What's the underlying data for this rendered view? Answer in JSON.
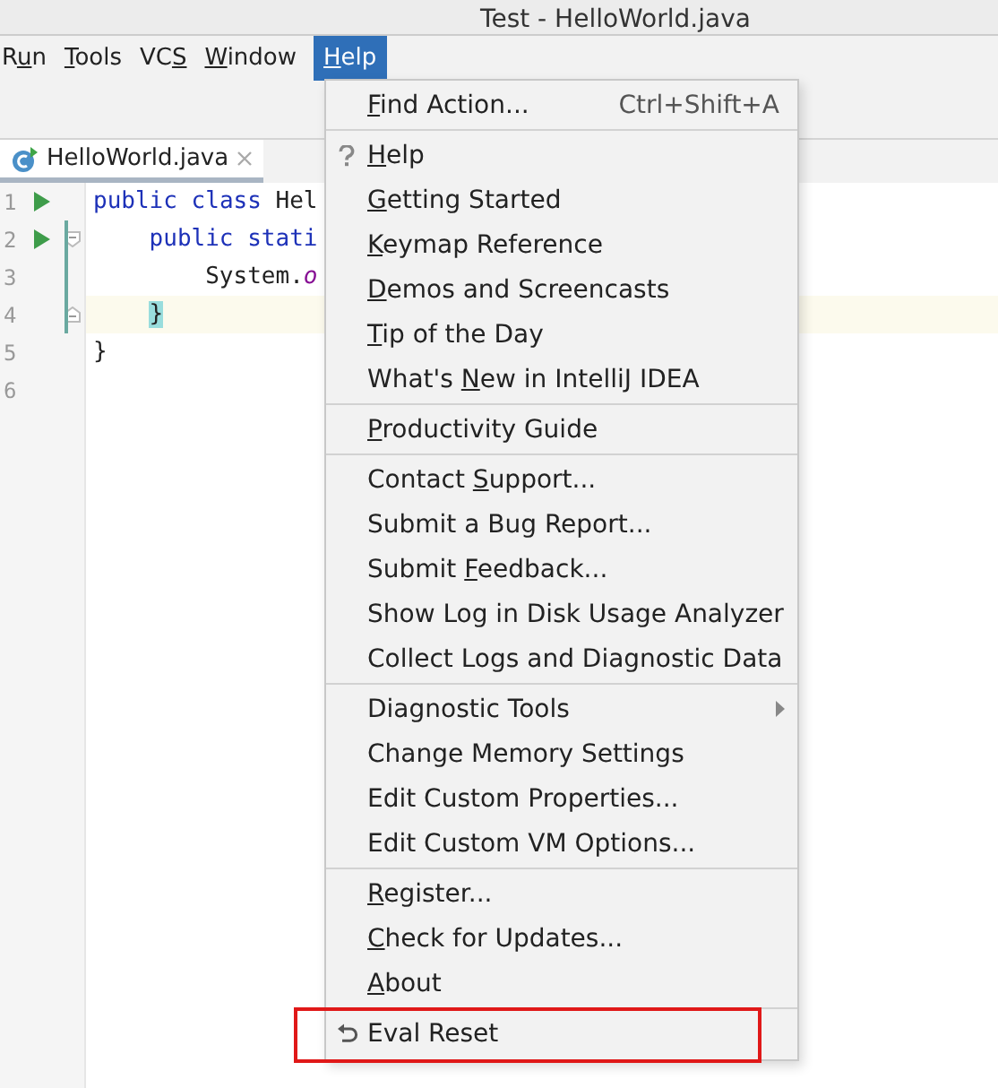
{
  "window": {
    "title": "Test - HelloWorld.java"
  },
  "menubar": [
    {
      "before": "R",
      "key": "u",
      "after": "n",
      "selected": false
    },
    {
      "key": "T",
      "after": "ools",
      "selected": false
    },
    {
      "before": "VC",
      "key": "S",
      "selected": false
    },
    {
      "key": "W",
      "after": "indow",
      "selected": false
    },
    {
      "key": "H",
      "after": "elp",
      "selected": true
    }
  ],
  "tab": {
    "label": "HelloWorld.java"
  },
  "editor": [
    {
      "number": "1",
      "run": true,
      "current": false,
      "tokens": [
        {
          "kind": "keyword",
          "text": "public class "
        },
        {
          "kind": "plain",
          "text": "Hel"
        }
      ],
      "children": [
        {
          "number": "2",
          "run": true,
          "fold_open": true,
          "current": false,
          "tokens": [
            {
              "kind": "keyword",
              "text": "public stati"
            }
          ],
          "children": [
            {
              "number": "3",
              "run": false,
              "current": false,
              "tokens": [
                {
                  "kind": "plain",
                  "text": "System."
                },
                {
                  "kind": "field",
                  "text": "o"
                }
              ]
            }
          ]
        },
        {
          "number": "4",
          "run": false,
          "fold_close": true,
          "current": true,
          "tokens": [
            {
              "kind": "brace-match",
              "text": "}"
            }
          ]
        }
      ]
    },
    {
      "number": "5",
      "run": false,
      "current": false,
      "tokens": [
        {
          "kind": "plain",
          "text": "}"
        }
      ]
    },
    {
      "number": "6",
      "run": false,
      "current": false
    }
  ],
  "menu": [
    [
      {
        "kind": "plain",
        "key": "F",
        "after": "ind Action...",
        "shortcut": "Ctrl+Shift+A"
      }
    ],
    [
      {
        "kind": "help",
        "key": "H",
        "after": "elp"
      },
      {
        "kind": "plain",
        "key": "G",
        "after": "etting Started"
      },
      {
        "kind": "plain",
        "key": "K",
        "after": "eymap Reference"
      },
      {
        "kind": "plain",
        "key": "D",
        "after": "emos and Screencasts"
      },
      {
        "kind": "plain",
        "key": "T",
        "after": "ip of the Day"
      },
      {
        "kind": "plain",
        "before": "What's ",
        "key": "N",
        "after": "ew in IntelliJ IDEA"
      }
    ],
    [
      {
        "kind": "plain",
        "key": "P",
        "after": "roductivity Guide"
      }
    ],
    [
      {
        "kind": "plain",
        "before": "Contact ",
        "key": "S",
        "after": "upport..."
      },
      {
        "kind": "plain",
        "before": "Submit a Bug Report..."
      },
      {
        "kind": "plain",
        "before": "Submit ",
        "key": "F",
        "after": "eedback..."
      },
      {
        "kind": "plain",
        "before": "Show Log in Disk Usage Analyzer"
      },
      {
        "kind": "plain",
        "before": "Collect Logs and Diagnostic Data"
      }
    ],
    [
      {
        "kind": "plain",
        "before": "Diagnostic Tools",
        "submenu": true
      },
      {
        "kind": "plain",
        "before": "Change Memory Settings"
      },
      {
        "kind": "plain",
        "before": "Edit Custom Properties..."
      },
      {
        "kind": "plain",
        "before": "Edit Custom VM Options..."
      }
    ],
    [
      {
        "kind": "plain",
        "key": "R",
        "after": "egister..."
      },
      {
        "kind": "plain",
        "key": "C",
        "after": "heck for Updates..."
      },
      {
        "kind": "plain",
        "key": "A",
        "after": "bout"
      }
    ],
    [
      {
        "kind": "undo",
        "before": "Eval Reset",
        "highlighted": true
      }
    ]
  ]
}
